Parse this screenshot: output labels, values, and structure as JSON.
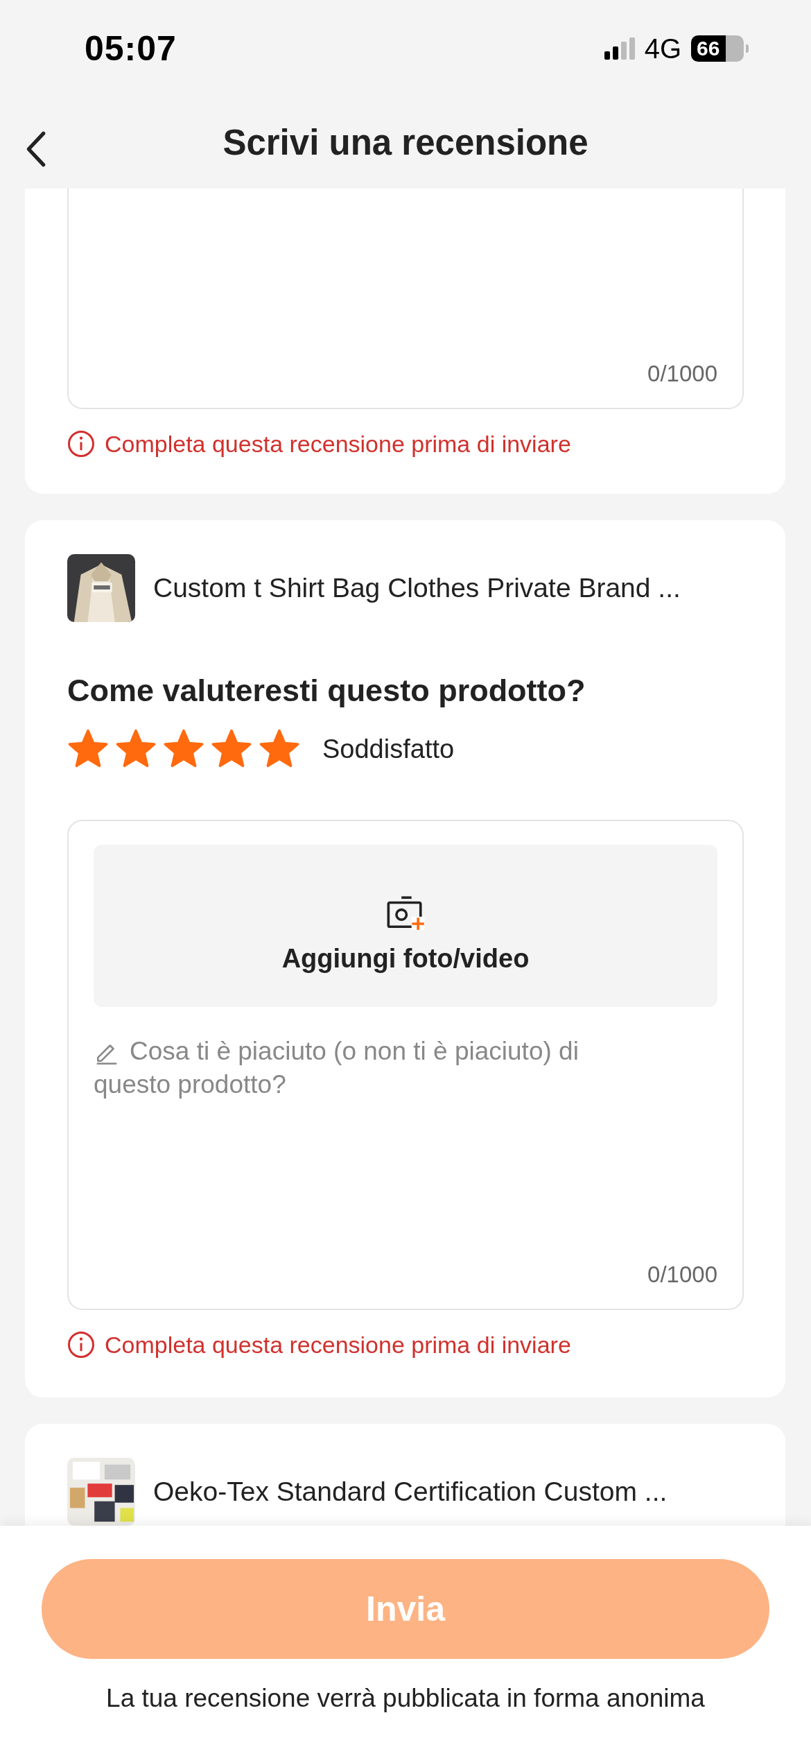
{
  "status_bar": {
    "time": "05:07",
    "network": "4G",
    "battery": "66"
  },
  "header": {
    "title": "Scrivi una recensione"
  },
  "reviews": [
    {
      "counter": "0/1000",
      "error": "Completa questa recensione prima di inviare"
    },
    {
      "product": "Custom t Shirt Bag Clothes Private Brand ...",
      "question": "Come valuteresti questo prodotto?",
      "stars": 5,
      "rating_label": "Soddisfatto",
      "upload_label": "Aggiungi foto/video",
      "placeholder": "Cosa ti è piaciuto (o non ti è piaciuto) di questo prodotto?",
      "counter": "0/1000",
      "error": "Completa questa recensione prima di inviare"
    },
    {
      "product": "Oeko-Tex Standard Certification Custom ..."
    }
  ],
  "submit": {
    "label": "Invia",
    "disabled": true
  },
  "note": "La tua recensione verrà pubblicata in forma anonima"
}
